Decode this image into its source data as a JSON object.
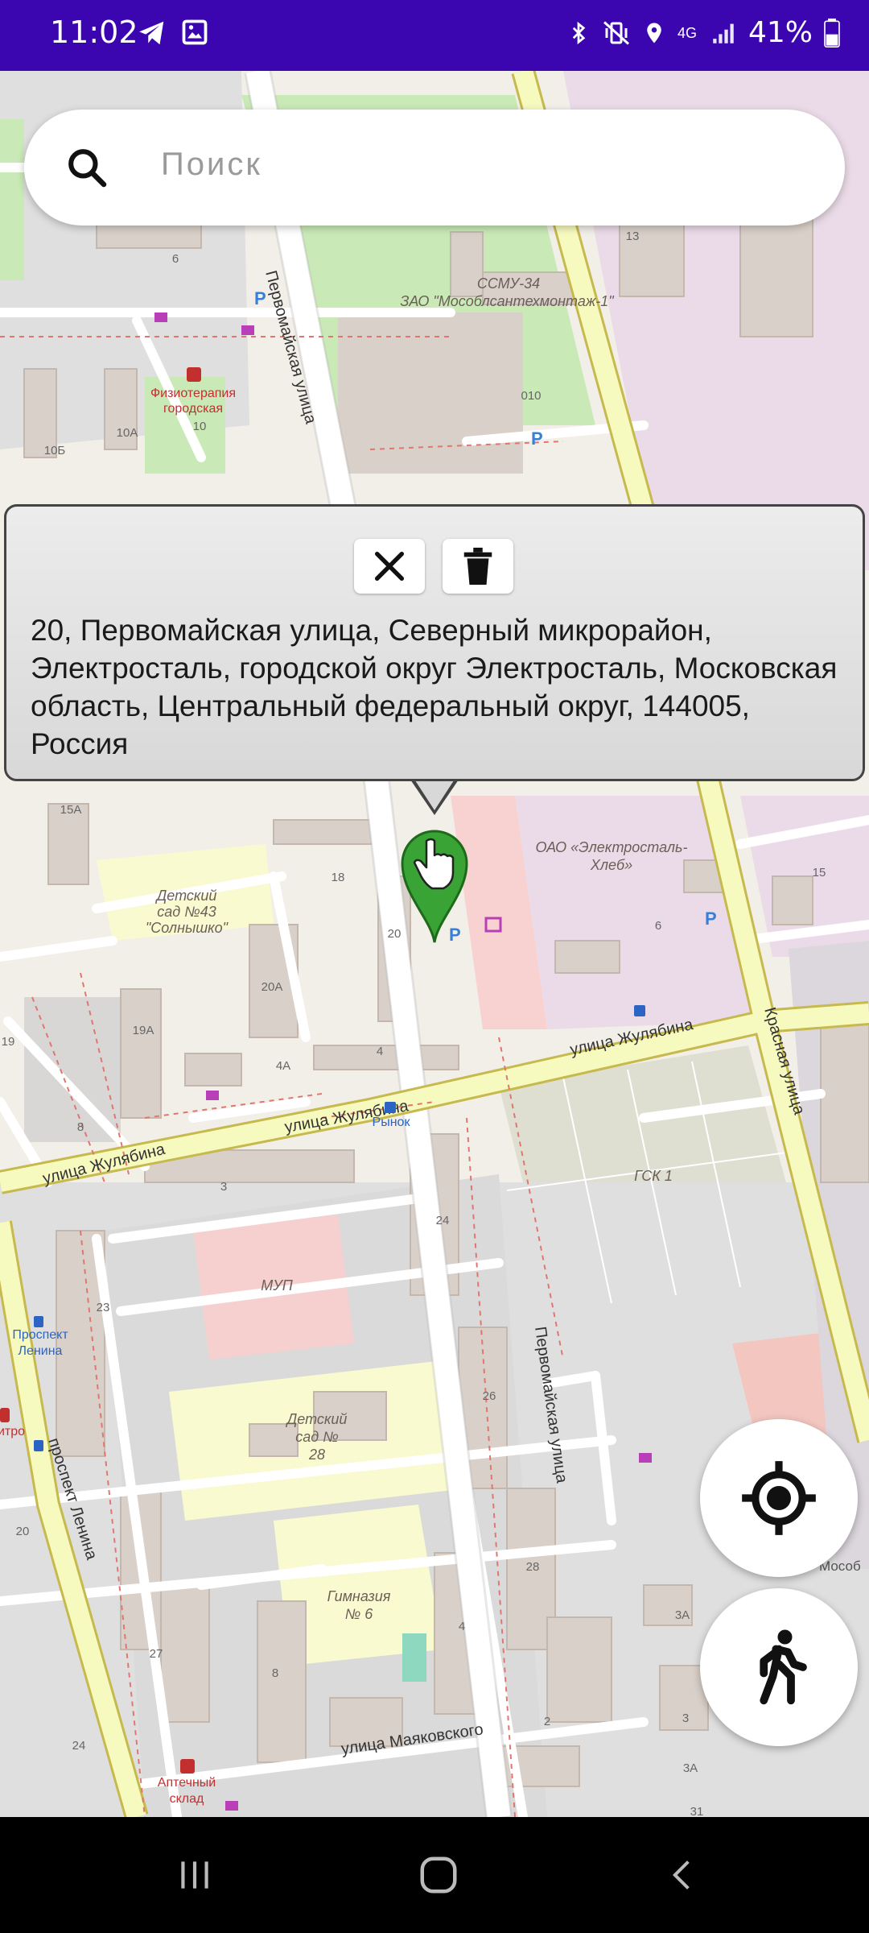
{
  "status_bar": {
    "time": "11:02",
    "battery": "41%",
    "network": "4G",
    "left_icons": [
      "telegram-icon",
      "gallery-icon"
    ],
    "right_icons": [
      "bluetooth-icon",
      "vibrate-icon",
      "location-icon",
      "signal-icon",
      "battery-icon"
    ]
  },
  "search": {
    "placeholder": "Поиск"
  },
  "popup": {
    "address": "20, Первомайская улица, Северный микрорайон, Электросталь, городской округ Электросталь, Московская область, Центральный федеральный округ, 144005, Россия",
    "buttons": [
      "close-icon",
      "trash-icon"
    ]
  },
  "map": {
    "labels": {
      "street_pervomayskaya_top": "Первомайская улица",
      "street_pervomayskaya_bottom": "Первомайская улица",
      "street_zhulyabina_1": "улица Жулябина",
      "street_zhulyabina_2": "улица Жулябина",
      "street_zhulyabina_3": "улица Жулябина",
      "street_krasnaya": "Красная улица",
      "street_lenina": "проспект Ленина",
      "street_mayakovskogo": "улица Маяковского",
      "smu": "ССМУ-34",
      "zao": "ЗАО \"Мособлсантехмонтаж-1\"",
      "physio_1": "Физиотерапия",
      "physio_2": "городская",
      "oao_1": "ОАО «Электросталь-",
      "oao_2": "Хлеб»",
      "kindergarten43_1": "Детский",
      "kindergarten43_2": "сад №43",
      "kindergarten43_3": "\"Солнышко\"",
      "gsk": "ГСК 1",
      "mup": "МУП",
      "kindergarten28_1": "Детский",
      "kindergarten28_2": "сад №",
      "kindergarten28_3": "28",
      "gymnasium_1": "Гимназия",
      "gymnasium_2": "№ 6",
      "pharmacy_1": "Аптечный",
      "pharmacy_2": "склад",
      "bus_rynok": "Рынок",
      "bus_prospekt_1": "Проспект",
      "bus_prospekt_2": "Ленина",
      "mosob": "Мособ",
      "itro": "итро"
    },
    "house_numbers": [
      "6",
      "10",
      "10А",
      "10Б",
      "13",
      "010",
      "18",
      "20",
      "20А",
      "19А",
      "4А",
      "4",
      "8",
      "3",
      "24",
      "23",
      "26",
      "28",
      "27",
      "8",
      "4",
      "2",
      "3А",
      "3",
      "3А",
      "24",
      "20",
      "15",
      "15А",
      "6",
      "19",
      "31"
    ]
  },
  "fabs": {
    "locate": "my-location-icon",
    "walk": "walking-person-icon"
  },
  "nav_bar": {
    "buttons": [
      "recent-apps-icon",
      "home-icon",
      "back-icon"
    ]
  },
  "colors": {
    "status_bar": "#3b06b0",
    "pin_green": "#3aa335",
    "popup_border": "#444444"
  }
}
